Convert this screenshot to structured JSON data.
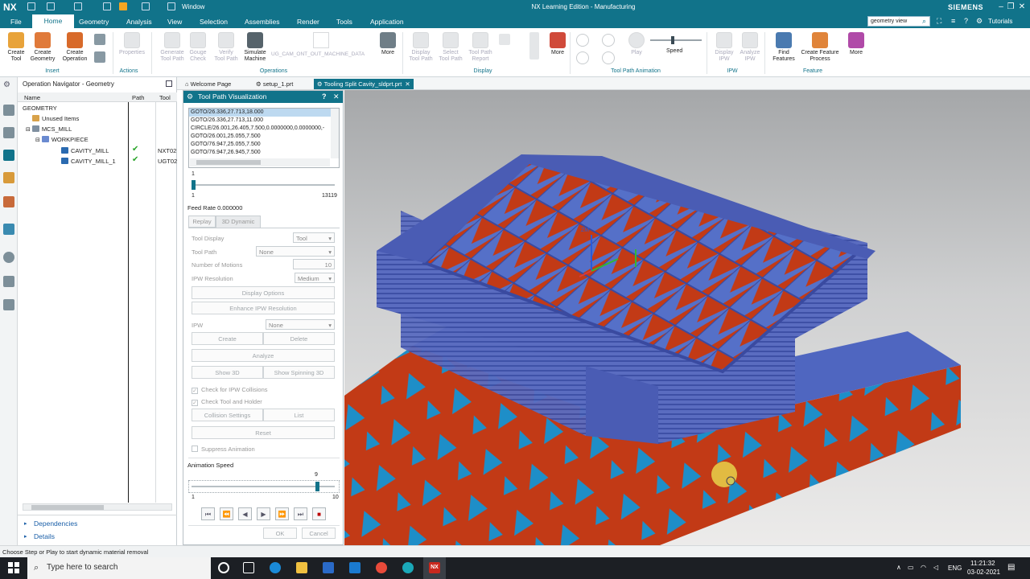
{
  "titlebar": {
    "logo": "NX",
    "window_menu": "Window",
    "title": "NX Learning Edition - Manufacturing",
    "brand": "SIEMENS"
  },
  "menubar": {
    "items": [
      "File",
      "Home",
      "Geometry",
      "Analysis",
      "View",
      "Selection",
      "Assemblies",
      "Render",
      "Tools",
      "Application"
    ],
    "search_value": "geometry view",
    "tutorials": "Tutorials"
  },
  "ribbon": {
    "buttons": [
      {
        "label": "Create\nTool",
        "icon": "create-tool-icon"
      },
      {
        "label": "Create\nGeometry",
        "icon": "create-geometry-icon"
      },
      {
        "label": "Create\nOperation",
        "icon": "create-operation-icon"
      },
      {
        "label": "Properties",
        "icon": "properties-icon"
      },
      {
        "label": "Generate\nTool Path",
        "icon": "generate-icon"
      },
      {
        "label": "Gouge\nCheck",
        "icon": "gouge-icon"
      },
      {
        "label": "Verify\nTool Path",
        "icon": "verify-icon"
      },
      {
        "label": "Simulate\nMachine",
        "icon": "simulate-icon"
      },
      {
        "label": "UG_CAM_ONT_OUT_MACHINE_DATA",
        "icon": "machine-data-icon"
      },
      {
        "label": "More",
        "icon": "more-icon"
      },
      {
        "label": "Display\nTool Path",
        "icon": "display-toolpath-icon"
      },
      {
        "label": "Select\nTool Path",
        "icon": "select-toolpath-icon"
      },
      {
        "label": "Tool Path\nReport",
        "icon": "report-icon"
      },
      {
        "label": "More",
        "icon": "more-icon"
      },
      {
        "label": "Play",
        "icon": "play-icon"
      },
      {
        "label": "Speed",
        "icon": "speed-slider"
      },
      {
        "label": "Display\nIPW",
        "icon": "display-ipw-icon"
      },
      {
        "label": "Analyze\nIPW",
        "icon": "analyze-ipw-icon"
      },
      {
        "label": "Find\nFeatures",
        "icon": "find-features-icon"
      },
      {
        "label": "Create Feature\nProcess",
        "icon": "feature-process-icon"
      },
      {
        "label": "More",
        "icon": "more-icon"
      }
    ],
    "groups": [
      "Insert",
      "Actions",
      "Operations",
      "Display",
      "Tool Path Animation",
      "IPW",
      "Feature"
    ]
  },
  "navigator": {
    "title": "Operation Navigator - Geometry",
    "columns": [
      "Name",
      "Path",
      "Tool"
    ],
    "rows": [
      {
        "name": "GEOMETRY",
        "tool": ""
      },
      {
        "name": "Unused Items",
        "tool": ""
      },
      {
        "name": "MCS_MILL",
        "tool": ""
      },
      {
        "name": "WORKPIECE",
        "tool": ""
      },
      {
        "name": "CAVITY_MILL",
        "tool": "NXT02"
      },
      {
        "name": "CAVITY_MILL_1",
        "tool": "UGT02"
      }
    ],
    "links": [
      "Dependencies",
      "Details"
    ]
  },
  "tabs": [
    "Welcome Page",
    "setup_1.prt",
    "Tooling Split Cavity_sldprt.prt"
  ],
  "dialog": {
    "title": "Tool Path Visualization",
    "lines": [
      "GOTO/26.336,27.713,18.000",
      "GOTO/26.336,27.713,11.000",
      "CIRCLE/26.001,26.405,7.500,0.0000000,0.0000000,-",
      "GOTO/26.001,25.055,7.500",
      "GOTO/76.947,25.055,7.500",
      "GOTO/76.947,26.945,7.500"
    ],
    "slider_value": "1",
    "slider_min": "1",
    "slider_max": "13119",
    "feed_rate": "Feed Rate 0.000000",
    "tab_replay": "Replay",
    "tab_3d": "3D Dynamic",
    "tool_display_label": "Tool Display",
    "tool_display_value": "Tool",
    "tool_path_label": "Tool Path",
    "tool_path_value": "None",
    "motions_label": "Number of Motions",
    "motions_value": "10",
    "ipw_res_label": "IPW Resolution",
    "ipw_res_value": "Medium",
    "display_options": "Display Options",
    "enhance": "Enhance IPW Resolution",
    "ipw_label": "IPW",
    "ipw_value": "None",
    "create": "Create",
    "delete": "Delete",
    "analyze": "Analyze",
    "show3d": "Show 3D",
    "spinning": "Show Spinning 3D",
    "check_ipw": "Check for IPW Collisions",
    "check_tool": "Check Tool and Holder",
    "collision_settings": "Collision Settings",
    "list": "List",
    "reset": "Reset",
    "suppress": "Suppress Animation",
    "anim_speed_label": "Animation Speed",
    "speed_value": "9",
    "speed_min": "1",
    "speed_max": "10",
    "ok": "OK",
    "cancel": "Cancel"
  },
  "viewport": {
    "axis_label": "ZM"
  },
  "status": {
    "text": "Choose Step or Play to start dynamic material removal"
  },
  "taskbar": {
    "search_placeholder": "Type here to search",
    "lang": "ENG",
    "time": "11:21:32",
    "date": "03-02-2021"
  },
  "colors": {
    "accent": "#11738a",
    "part_red": "#c23a16",
    "part_blue": "#5570c8",
    "part_cyan": "#1e8ec8"
  }
}
